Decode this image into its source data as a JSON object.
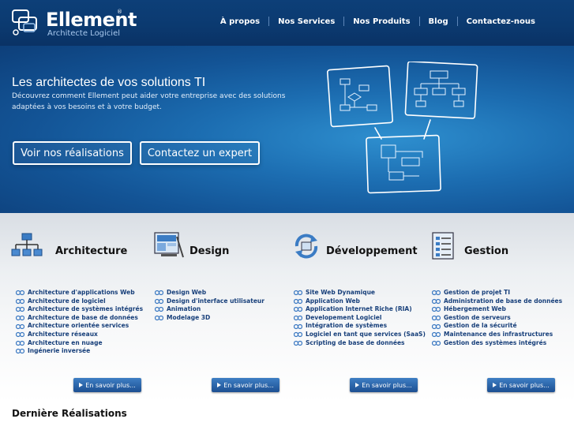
{
  "brand": {
    "name": "Ellement",
    "tm": "®",
    "tagline": "Architecte Logiciel"
  },
  "nav": [
    "À propos",
    "Nos Services",
    "Nos Produits",
    "Blog",
    "Contactez-nous"
  ],
  "hero": {
    "title": "Les architectes de vos solutions TI",
    "subtitle": "Découvrez comment Ellement peut aider votre entreprise avec des solutions adaptées à vos besoins et à votre budget.",
    "buttons": [
      "Voir nos réalisations",
      "Contactez un expert"
    ]
  },
  "columns": [
    {
      "title": "Architecture",
      "icon": "network-hierarchy-icon",
      "items": [
        "Architecture d'applications Web",
        "Architecture de logiciel",
        "Architecture de systèmes intégrés",
        "Architecture de base de données",
        "Architecture orientée services",
        "Architecture réseaux",
        "Architecture en nuage",
        "Ingénerie inversée"
      ],
      "more": "En savoir plus..."
    },
    {
      "title": "Design",
      "icon": "monitor-design-icon",
      "items": [
        "Design Web",
        "Design d'interface utilisateur",
        "Animation",
        "Modelage 3D"
      ],
      "more": "En savoir plus..."
    },
    {
      "title": "Développement",
      "icon": "cycle-arrows-icon",
      "items": [
        "Site Web Dynamique",
        "Application Web",
        "Application Internet Riche (RIA)",
        "Developement Logiciel",
        "Intégration de systèmes",
        "Logiciel en tant que services (SaaS)",
        "Scripting de base de données"
      ],
      "more": "En savoir plus..."
    },
    {
      "title": "Gestion",
      "icon": "checklist-icon",
      "items": [
        "Gestion de projet TI",
        "Administration de base de données",
        "Hébergement Web",
        "Gestion de serveurs",
        "Gestion de la sécurité",
        "Maintenance des infrastructures",
        "Gestion des systèmes intégrés"
      ],
      "more": "En savoir plus..."
    }
  ],
  "recent_title": "Dernière Réalisations",
  "colors": {
    "header": "#0b3a70",
    "link": "#173f7a",
    "button": "#1c4f92"
  }
}
